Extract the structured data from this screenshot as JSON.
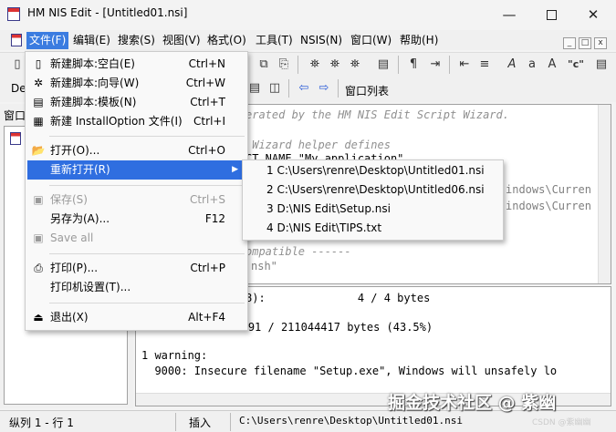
{
  "window": {
    "title": "HM NIS Edit - [Untitled01.nsi]",
    "minimize": "—",
    "close": "✕"
  },
  "menubar": {
    "items": [
      "文件(F)",
      "编辑(E)",
      "搜索(S)",
      "视图(V)",
      "格式(O)",
      "工具(T)",
      "NSIS(N)",
      "窗口(W)",
      "帮助(H)"
    ],
    "mdi_buttons": [
      "_",
      "□",
      "x"
    ]
  },
  "toolbar": {
    "dropdown_partial": "De",
    "list_label": "窗口列表",
    "font_a": "A",
    "font_a_small": "a",
    "quote_c": "\"c\"",
    "para": "¶",
    "bino": "⛯"
  },
  "left_pane": {
    "header": "窗口"
  },
  "file_menu": {
    "items": [
      {
        "label": "新建脚本:空白(E)",
        "shortcut": "Ctrl+N",
        "icon": "new-blank-icon",
        "glyph": "▯"
      },
      {
        "label": "新建脚本:向导(W)",
        "shortcut": "Ctrl+W",
        "icon": "wizard-icon",
        "glyph": "✲"
      },
      {
        "label": "新建脚本:模板(N)",
        "shortcut": "Ctrl+T",
        "icon": "template-icon",
        "glyph": "▤"
      },
      {
        "label": "新建 InstallOption 文件(I)",
        "shortcut": "Ctrl+I",
        "icon": "installoption-icon",
        "glyph": "▦"
      },
      {
        "label": "打开(O)...",
        "shortcut": "Ctrl+O",
        "icon": "open-folder-icon",
        "glyph": "📂"
      },
      {
        "label": "重新打开(R)",
        "shortcut": "",
        "icon": "",
        "glyph": ""
      },
      {
        "label": "保存(S)",
        "shortcut": "Ctrl+S",
        "icon": "save-icon",
        "glyph": "▣"
      },
      {
        "label": "另存为(A)...",
        "shortcut": "F12",
        "icon": "",
        "glyph": ""
      },
      {
        "label": "Save all",
        "shortcut": "",
        "icon": "save-all-icon",
        "glyph": "▣"
      },
      {
        "label": "打印(P)...",
        "shortcut": "Ctrl+P",
        "icon": "print-icon",
        "glyph": "⎙"
      },
      {
        "label": "打印机设置(T)...",
        "shortcut": "",
        "icon": "",
        "glyph": ""
      },
      {
        "label": "退出(X)",
        "shortcut": "Alt+F4",
        "icon": "exit-icon",
        "glyph": "⏏"
      }
    ],
    "submenu_arrow": "▶"
  },
  "recent_files": [
    "1 C:\\Users\\renre\\Desktop\\Untitled01.nsi",
    "2 C:\\Users\\renre\\Desktop\\Untitled06.nsi",
    "3 D:\\NIS Edit\\Setup.nsi",
    "4 D:\\NIS Edit\\TIPS.txt"
  ],
  "editor": {
    "lines": [
      "erated by the HM NIS Edit Script Wizard.",
      " Wizard helper defines",
      "CT_NAME \"My application\"",
      "indows\\Curren",
      "indows\\Curren",
      "ompatible ------",
      "nsh\""
    ]
  },
  "output": {
    "lines": [
      "8):              4 / 4 bytes",
      "           91843591 / 211044417 bytes (43.5%)",
      "1 warning:",
      "  9000: Insecure filename \"Setup.exe\", Windows will unsafely lo"
    ]
  },
  "statusbar": {
    "position": "纵列 1 - 行 1",
    "mode": "插入",
    "path": "C:\\Users\\renre\\Desktop\\Untitled01.nsi"
  },
  "watermark": {
    "text": "掘金技术社区 @ 紫幽",
    "sub": "CSDN @紫幽幽"
  }
}
